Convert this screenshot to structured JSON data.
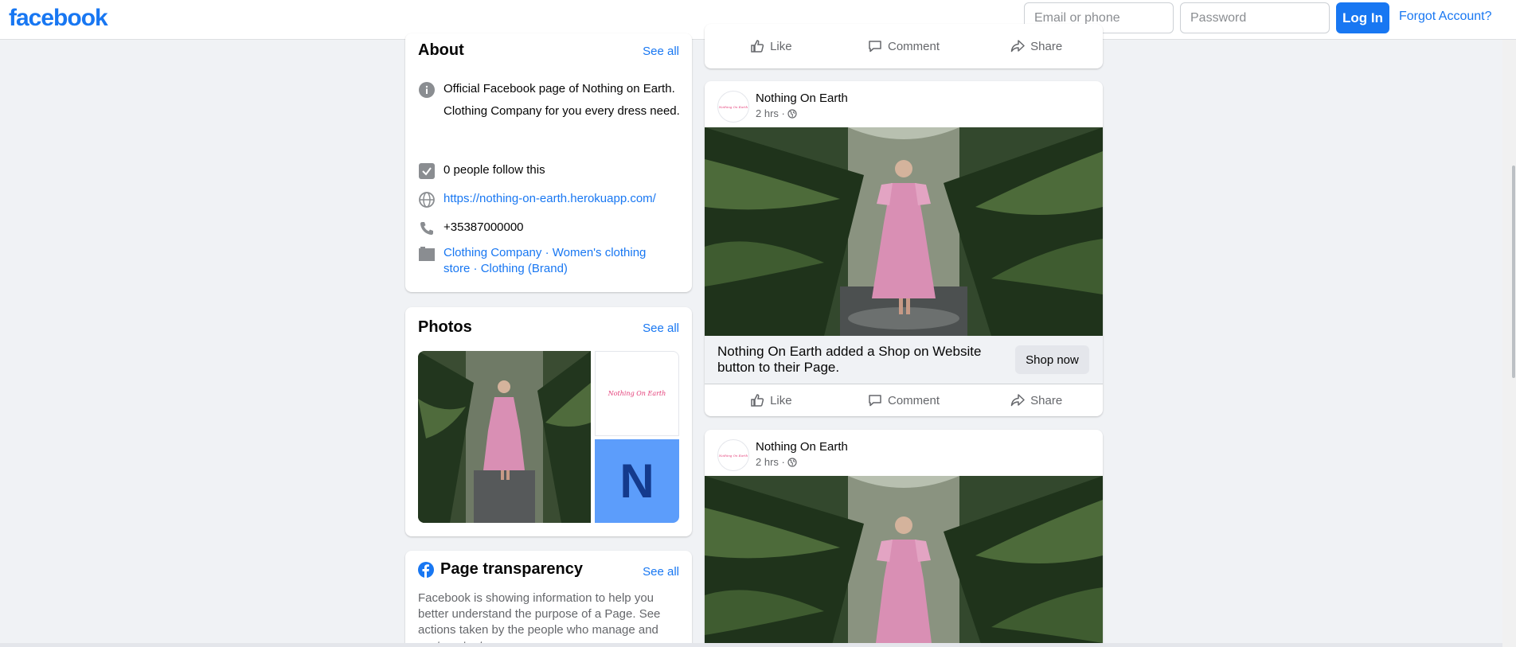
{
  "header": {
    "logo": "facebook",
    "email_placeholder": "Email or phone",
    "password_placeholder": "Password",
    "login_label": "Log In",
    "forgot_label": "Forgot Account?"
  },
  "about": {
    "title": "About",
    "see_all": "See all",
    "description_1": "Official Facebook page of Nothing on Earth.",
    "description_2": "Clothing Company for you every dress need.",
    "followers": "0 people follow this",
    "website": "https://nothing-on-earth.herokuapp.com/",
    "phone": "+35387000000",
    "category_1": "Clothing Company",
    "category_2": "Women's clothing store",
    "category_3": "Clothing (Brand)"
  },
  "photos": {
    "title": "Photos",
    "see_all": "See all",
    "logo_text": "Nothing On Earth",
    "letter": "N"
  },
  "transparency": {
    "title": "Page transparency",
    "see_all": "See all",
    "text": "Facebook is showing information to help you better understand the purpose of a Page. See actions taken by the people who manage and post content."
  },
  "post_actions": {
    "like": "Like",
    "comment": "Comment",
    "share": "Share"
  },
  "posts": [
    {
      "author": "Nothing On Earth",
      "time": "2 hrs ·",
      "avatar_text": "Nothing On Earth",
      "cta_text": "Nothing On Earth added a Shop on Website button to their Page.",
      "cta_button": "Shop now"
    },
    {
      "author": "Nothing On Earth",
      "time": "2 hrs ·",
      "avatar_text": "Nothing On Earth"
    }
  ],
  "colors": {
    "brand": "#1877f2",
    "background": "#f0f2f5",
    "dress_pink": "#d98fb4",
    "foliage": "#2f4a2a"
  }
}
